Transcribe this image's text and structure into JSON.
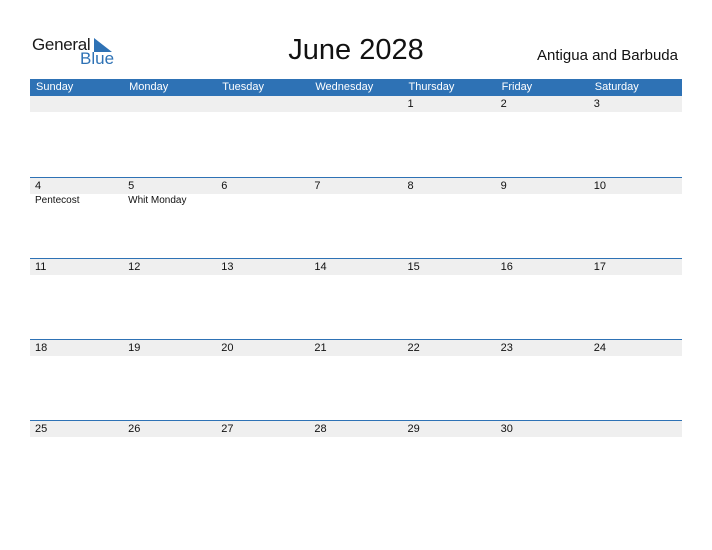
{
  "logo": {
    "general": "General",
    "blue": "Blue"
  },
  "title": "June 2028",
  "country": "Antigua and Barbuda",
  "colors": {
    "accent": "#2e72b5",
    "row_bg": "#efefef"
  },
  "weekdays": [
    "Sunday",
    "Monday",
    "Tuesday",
    "Wednesday",
    "Thursday",
    "Friday",
    "Saturday"
  ],
  "weeks": [
    {
      "days": [
        "",
        "",
        "",
        "",
        "1",
        "2",
        "3"
      ],
      "events": [
        "",
        "",
        "",
        "",
        "",
        "",
        ""
      ]
    },
    {
      "days": [
        "4",
        "5",
        "6",
        "7",
        "8",
        "9",
        "10"
      ],
      "events": [
        "Pentecost",
        "Whit Monday",
        "",
        "",
        "",
        "",
        ""
      ]
    },
    {
      "days": [
        "11",
        "12",
        "13",
        "14",
        "15",
        "16",
        "17"
      ],
      "events": [
        "",
        "",
        "",
        "",
        "",
        "",
        ""
      ]
    },
    {
      "days": [
        "18",
        "19",
        "20",
        "21",
        "22",
        "23",
        "24"
      ],
      "events": [
        "",
        "",
        "",
        "",
        "",
        "",
        ""
      ]
    },
    {
      "days": [
        "25",
        "26",
        "27",
        "28",
        "29",
        "30",
        ""
      ],
      "events": [
        "",
        "",
        "",
        "",
        "",
        "",
        ""
      ]
    }
  ]
}
